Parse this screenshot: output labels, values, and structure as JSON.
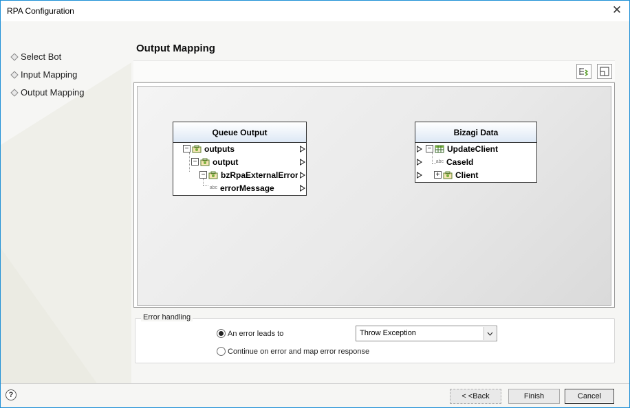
{
  "window": {
    "title": "RPA Configuration",
    "close_icon": "close-icon"
  },
  "sidebar": {
    "items": [
      {
        "label": "Select Bot"
      },
      {
        "label": "Input Mapping"
      },
      {
        "label": "Output Mapping"
      }
    ]
  },
  "main": {
    "title": "Output Mapping",
    "toolbar": {
      "icons": [
        "auto-map-icon",
        "layout-icon"
      ]
    }
  },
  "mapping": {
    "source": {
      "title": "Queue Output",
      "nodes": [
        {
          "label": "outputs"
        },
        {
          "label": "output"
        },
        {
          "label": "bzRpaExternalError"
        },
        {
          "label": "errorMessage",
          "type_tag": "abc"
        }
      ]
    },
    "target": {
      "title": "Bizagi Data",
      "nodes": [
        {
          "label": "UpdateClient"
        },
        {
          "label": "CaseId",
          "type_tag": "abc"
        },
        {
          "label": "Client"
        }
      ]
    }
  },
  "error_handling": {
    "legend": "Error handling",
    "option_error_leads_to": "An error leads to",
    "option_continue": "Continue on error and map error response",
    "selected_option": "An error leads to",
    "select_value": "Throw Exception"
  },
  "footer": {
    "help_glyph": "?",
    "back_label": "< <Back",
    "finish_label": "Finish",
    "cancel_label": "Cancel"
  },
  "colors": {
    "accent_border": "#1c8fd6",
    "panel_header": "#dde8f5"
  }
}
